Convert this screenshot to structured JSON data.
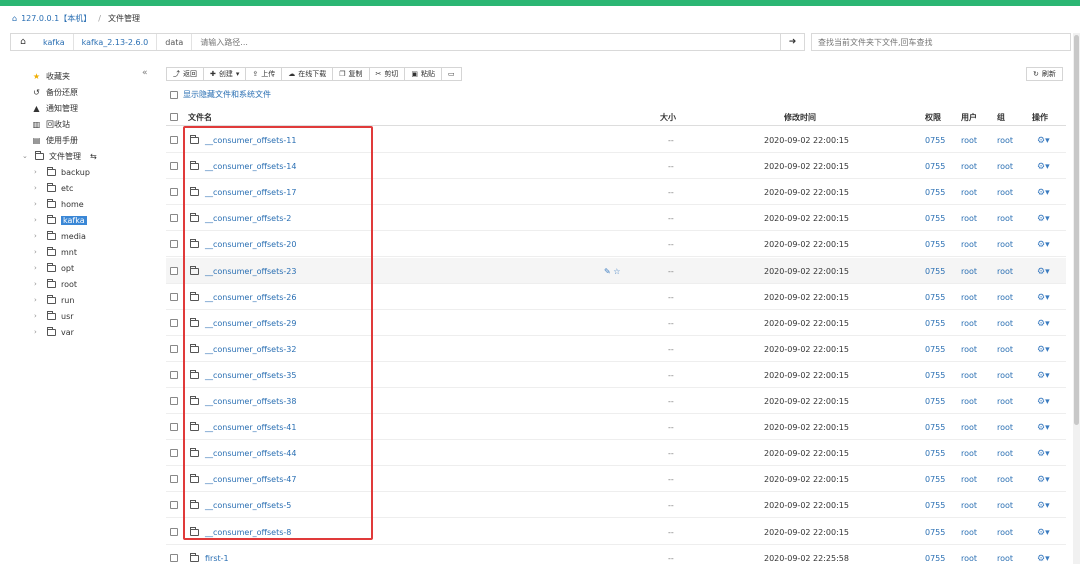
{
  "breadcrumb": {
    "host": "127.0.0.1【本机】",
    "separator": "/",
    "current": "文件管理"
  },
  "path": {
    "segments": [
      "kafka",
      "kafka_2.13-2.6.0",
      "data"
    ],
    "placeholder": "请输入路径...",
    "go_icon": "arrow-right-icon"
  },
  "search": {
    "placeholder": "查找当前文件夹下文件,回车查找"
  },
  "sidebar": {
    "collapse_icon": "«",
    "items": [
      {
        "label": "收藏夹",
        "icon": "star-icon"
      },
      {
        "label": "备份还原",
        "icon": "history-icon"
      },
      {
        "label": "通知管理",
        "icon": "bell-icon"
      },
      {
        "label": "回收站",
        "icon": "trash-icon"
      },
      {
        "label": "使用手册",
        "icon": "book-icon"
      },
      {
        "label": "文件管理",
        "icon": "folder-icon"
      }
    ],
    "tree": [
      "backup",
      "etc",
      "home",
      "kafka",
      "media",
      "mnt",
      "opt",
      "root",
      "run",
      "usr",
      "var"
    ],
    "selected": "kafka"
  },
  "toolbar": {
    "buttons": [
      "返回",
      "创建",
      "上传",
      "在线下载",
      "复制",
      "剪切",
      "粘贴"
    ],
    "refresh": "刷新"
  },
  "show_hidden_label": "显示隐藏文件和系统文件",
  "table": {
    "headers": {
      "name": "文件名",
      "size": "大小",
      "mtime": "修改时间",
      "perm": "权限",
      "user": "用户",
      "group": "组",
      "ops": "操作"
    },
    "rows": [
      {
        "name": "__consumer_offsets-11",
        "size": "--",
        "mtime": "2020-09-02 22:00:15",
        "perm": "0755",
        "user": "root",
        "group": "root"
      },
      {
        "name": "__consumer_offsets-14",
        "size": "--",
        "mtime": "2020-09-02 22:00:15",
        "perm": "0755",
        "user": "root",
        "group": "root"
      },
      {
        "name": "__consumer_offsets-17",
        "size": "--",
        "mtime": "2020-09-02 22:00:15",
        "perm": "0755",
        "user": "root",
        "group": "root"
      },
      {
        "name": "__consumer_offsets-2",
        "size": "--",
        "mtime": "2020-09-02 22:00:15",
        "perm": "0755",
        "user": "root",
        "group": "root"
      },
      {
        "name": "__consumer_offsets-20",
        "size": "--",
        "mtime": "2020-09-02 22:00:15",
        "perm": "0755",
        "user": "root",
        "group": "root"
      },
      {
        "name": "__consumer_offsets-23",
        "size": "--",
        "mtime": "2020-09-02 22:00:15",
        "perm": "0755",
        "user": "root",
        "group": "root"
      },
      {
        "name": "__consumer_offsets-26",
        "size": "--",
        "mtime": "2020-09-02 22:00:15",
        "perm": "0755",
        "user": "root",
        "group": "root"
      },
      {
        "name": "__consumer_offsets-29",
        "size": "--",
        "mtime": "2020-09-02 22:00:15",
        "perm": "0755",
        "user": "root",
        "group": "root"
      },
      {
        "name": "__consumer_offsets-32",
        "size": "--",
        "mtime": "2020-09-02 22:00:15",
        "perm": "0755",
        "user": "root",
        "group": "root"
      },
      {
        "name": "__consumer_offsets-35",
        "size": "--",
        "mtime": "2020-09-02 22:00:15",
        "perm": "0755",
        "user": "root",
        "group": "root"
      },
      {
        "name": "__consumer_offsets-38",
        "size": "--",
        "mtime": "2020-09-02 22:00:15",
        "perm": "0755",
        "user": "root",
        "group": "root"
      },
      {
        "name": "__consumer_offsets-41",
        "size": "--",
        "mtime": "2020-09-02 22:00:15",
        "perm": "0755",
        "user": "root",
        "group": "root"
      },
      {
        "name": "__consumer_offsets-44",
        "size": "--",
        "mtime": "2020-09-02 22:00:15",
        "perm": "0755",
        "user": "root",
        "group": "root"
      },
      {
        "name": "__consumer_offsets-47",
        "size": "--",
        "mtime": "2020-09-02 22:00:15",
        "perm": "0755",
        "user": "root",
        "group": "root"
      },
      {
        "name": "__consumer_offsets-5",
        "size": "--",
        "mtime": "2020-09-02 22:00:15",
        "perm": "0755",
        "user": "root",
        "group": "root"
      },
      {
        "name": "__consumer_offsets-8",
        "size": "--",
        "mtime": "2020-09-02 22:00:15",
        "perm": "0755",
        "user": "root",
        "group": "root"
      },
      {
        "name": "first-1",
        "size": "--",
        "mtime": "2020-09-02 22:25:58",
        "perm": "0755",
        "user": "root",
        "group": "root"
      }
    ],
    "hover_row": 5
  },
  "colors": {
    "accent": "#2bb673",
    "link": "#2a6fb3",
    "highlight_box": "#e03a3a"
  }
}
